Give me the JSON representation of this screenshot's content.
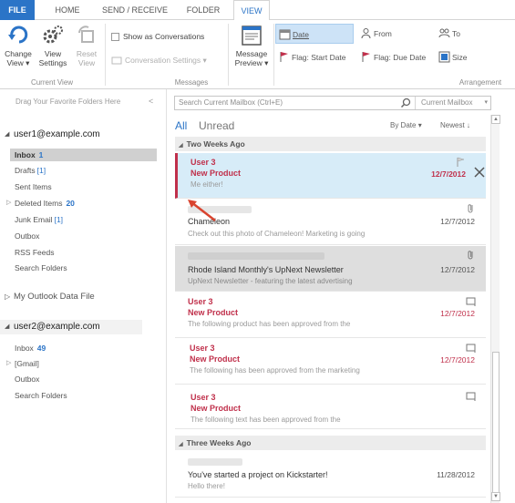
{
  "ribbon": {
    "tabs": [
      {
        "label": "FILE"
      },
      {
        "label": "HOME"
      },
      {
        "label": "SEND / RECEIVE"
      },
      {
        "label": "FOLDER"
      },
      {
        "label": "VIEW"
      }
    ],
    "current_view": {
      "change_view": "Change View",
      "view_settings": "View Settings",
      "reset_view": "Reset View",
      "group_label": "Current View"
    },
    "messages": {
      "show_as_conversations": "Show as Conversations",
      "conversation_settings": "Conversation Settings",
      "message_preview": "Message Preview",
      "group_label": "Messages"
    },
    "arrangement": {
      "date": "Date",
      "from": "From",
      "to": "To",
      "flag_start_date": "Flag: Start Date",
      "flag_due_date": "Flag: Due Date",
      "size": "Size",
      "group_label": "Arrangement"
    }
  },
  "folder_pane": {
    "favorites_hint": "Drag Your Favorite Folders Here",
    "accounts": [
      {
        "name": "user1@example.com",
        "folders": [
          {
            "label": "Inbox",
            "count": "1"
          },
          {
            "label": "Drafts",
            "count": "[1]"
          },
          {
            "label": "Sent Items",
            "count": ""
          },
          {
            "label": "Deleted Items",
            "count": "20"
          },
          {
            "label": "Junk Email",
            "count": "[1]"
          },
          {
            "label": "Outbox",
            "count": ""
          },
          {
            "label": "RSS Feeds",
            "count": ""
          },
          {
            "label": "Search Folders",
            "count": ""
          }
        ]
      },
      {
        "name": "My Outlook Data File"
      },
      {
        "name": "user2@example.com",
        "folders": [
          {
            "label": "Inbox",
            "count": "49"
          },
          {
            "label": "[Gmail]",
            "count": ""
          },
          {
            "label": "Outbox",
            "count": ""
          },
          {
            "label": "Search Folders",
            "count": ""
          }
        ]
      }
    ]
  },
  "message_list": {
    "search_placeholder": "Search Current Mailbox (Ctrl+E)",
    "search_scope": "Current Mailbox",
    "filter_all": "All",
    "filter_unread": "Unread",
    "sort_by": "By Date",
    "sort_order": "Newest",
    "groups": [
      {
        "label": "Two Weeks Ago",
        "messages": [
          {
            "from": "User 3",
            "subject": "New Product",
            "preview": "Me either!",
            "date": "12/7/2012",
            "unread": true
          },
          {
            "from": "",
            "subject": "Chameleon",
            "preview": "Check out this photo of Chameleon!  Marketing is going",
            "date": "12/7/2012",
            "unread": false
          },
          {
            "from": "",
            "subject": "Rhode Island Monthly's UpNext Newsletter",
            "preview": "UpNext Newsletter - featuring the latest advertising",
            "date": "12/7/2012",
            "unread": false
          },
          {
            "from": "User 3",
            "subject": "New Product",
            "preview": "The following product has been approved from the",
            "date": "12/7/2012",
            "unread": true
          },
          {
            "from": "User 3",
            "subject": "New Product",
            "preview": "The following has been approved from the marketing",
            "date": "12/7/2012",
            "unread": true
          },
          {
            "from": "User 3",
            "subject": "New Product",
            "preview": "The following text has been approved from the",
            "date": "",
            "unread": true
          }
        ]
      },
      {
        "label": "Three Weeks Ago",
        "messages": [
          {
            "from": "",
            "subject": "You've started a project on Kickstarter!",
            "preview": "Hello there!",
            "date": "11/28/2012",
            "unread": false
          }
        ]
      }
    ]
  },
  "colors": {
    "accent": "#2b74c7",
    "unread": "#c0304b",
    "selected_bg": "#d7ecf8"
  }
}
